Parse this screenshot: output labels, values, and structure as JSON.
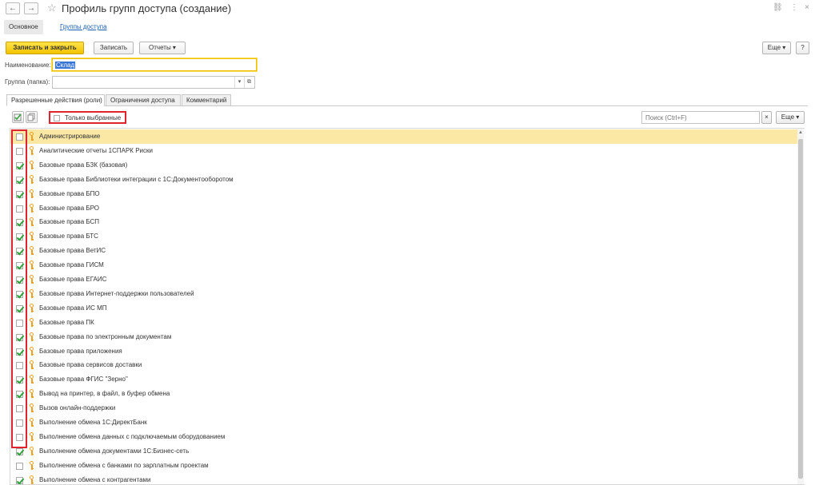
{
  "window": {
    "title": "Профиль групп доступа (создание)",
    "back_glyph": "←",
    "forward_glyph": "→",
    "star_glyph": "☆",
    "link_glyph": "⛓",
    "menu_glyph": "⋮",
    "close_glyph": "×"
  },
  "sections": [
    "Основное",
    "Группы доступа"
  ],
  "toolbar": {
    "save_close": "Записать и закрыть",
    "save": "Записать",
    "reports": "Отчеты ▾",
    "more": "Еще ▾",
    "help": "?"
  },
  "form": {
    "name_label": "Наименование:",
    "name_value": "Склад",
    "group_label": "Группа (папка):",
    "group_value": ""
  },
  "tabs": [
    "Разрешенные действия (роли)",
    "Ограничения доступа",
    "Комментарий"
  ],
  "list_toolbar": {
    "only_selected": "Только выбранные",
    "search_placeholder": "Поиск (Ctrl+F)",
    "clear": "×",
    "more": "Еще ▾"
  },
  "roles": [
    {
      "name": "Администрирование",
      "checked": false
    },
    {
      "name": "Аналитические отчеты 1СПАРК Риски",
      "checked": false
    },
    {
      "name": "Базовые права БЗК (базовая)",
      "checked": true
    },
    {
      "name": "Базовые права Библиотеки интеграции с 1С:Документооборотом",
      "checked": true
    },
    {
      "name": "Базовые права БПО",
      "checked": true
    },
    {
      "name": "Базовые права БРО",
      "checked": false
    },
    {
      "name": "Базовые права БСП",
      "checked": true
    },
    {
      "name": "Базовые права БТС",
      "checked": true
    },
    {
      "name": "Базовые права ВетИС",
      "checked": true
    },
    {
      "name": "Базовые права ГИСМ",
      "checked": true
    },
    {
      "name": "Базовые права ЕГАИС",
      "checked": true
    },
    {
      "name": "Базовые права Интернет-поддержки пользователей",
      "checked": true
    },
    {
      "name": "Базовые права ИС МП",
      "checked": true
    },
    {
      "name": "Базовые права ПК",
      "checked": false
    },
    {
      "name": "Базовые права по электронным документам",
      "checked": true
    },
    {
      "name": "Базовые права приложения",
      "checked": true
    },
    {
      "name": "Базовые права сервисов доставки",
      "checked": false
    },
    {
      "name": "Базовые права ФГИС \"Зерно\"",
      "checked": true
    },
    {
      "name": "Вывод на принтер, в файл, в буфер обмена",
      "checked": true
    },
    {
      "name": "Вызов онлайн-поддержки",
      "checked": false
    },
    {
      "name": "Выполнение обмена 1С:ДиректБанк",
      "checked": false
    },
    {
      "name": "Выполнение обмена данных с подключаемым оборудованием",
      "checked": false
    },
    {
      "name": "Выполнение обмена документами 1С:Бизнес-сеть",
      "checked": true
    },
    {
      "name": "Выполнение обмена с банками по зарплатным проектам",
      "checked": false
    },
    {
      "name": "Выполнение обмена с контрагентами",
      "checked": true
    }
  ]
}
